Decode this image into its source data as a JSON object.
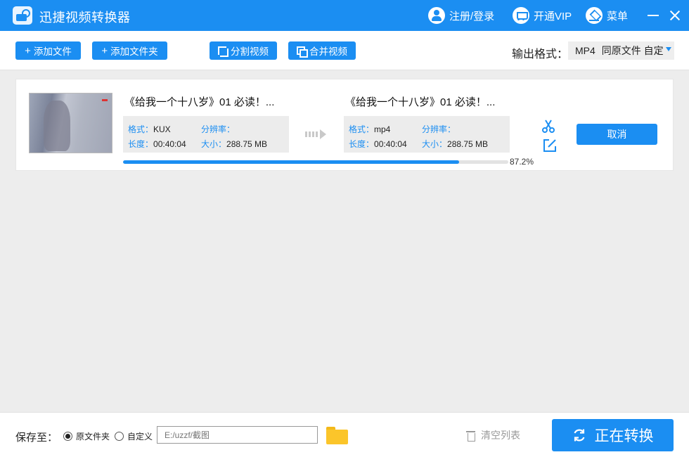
{
  "app": {
    "title": "迅捷视频转换器"
  },
  "titlebar": {
    "login_label": "注册/登录",
    "vip_label": "开通VIP",
    "menu_label": "菜单"
  },
  "toolbar": {
    "add_file": "添加文件",
    "add_folder": "添加文件夹",
    "split_video": "分割视频",
    "merge_video": "合并视频",
    "output_format_label": "输出格式：",
    "output_format_value": "MP4",
    "output_quality_value": "同原文件 自定"
  },
  "file_item": {
    "source": {
      "name": "《给我一个十八岁》01 必读！...",
      "format_label": "格式：",
      "format": "KUX",
      "resolution_label": "分辨率：",
      "resolution": "",
      "duration_label": "长度：",
      "duration": "00:40:04",
      "size_label": "大小：",
      "size": "288.75 MB"
    },
    "target": {
      "name": "《给我一个十八岁》01 必读！...",
      "format_label": "格式：",
      "format": "mp4",
      "resolution_label": "分辨率：",
      "resolution": "",
      "duration_label": "长度：",
      "duration": "00:40:04",
      "size_label": "大小：",
      "size": "288.75 MB"
    },
    "cancel_label": "取消",
    "progress_percent": 87.2,
    "progress_text": "87.2%"
  },
  "bottom": {
    "save_to_label": "保存至：",
    "option_original": "原文件夹",
    "option_custom": "自定义",
    "selected_option": "original",
    "path_placeholder": "E:/uzzf/截图",
    "clear_list_label": "清空列表",
    "convert_label": "正在转换"
  },
  "colors": {
    "accent": "#1b8ef2",
    "background": "#ededed",
    "folder": "#fbc52a"
  }
}
